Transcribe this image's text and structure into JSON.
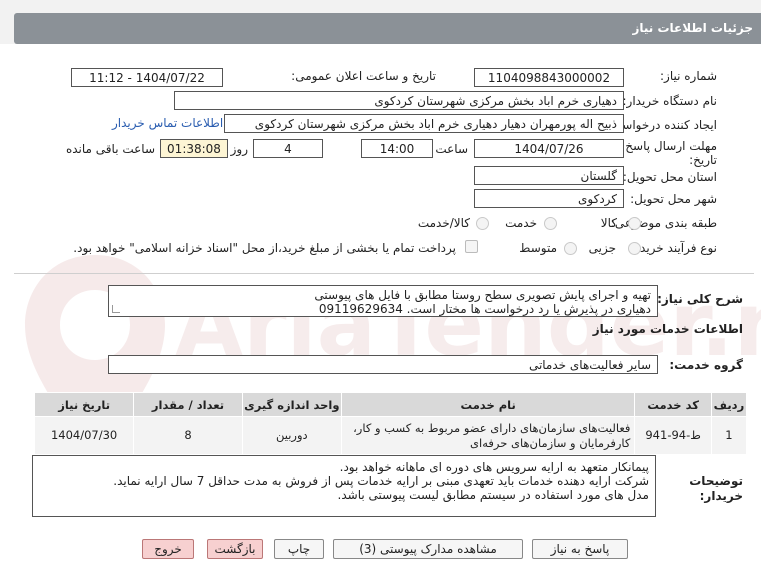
{
  "header": {
    "title": "جزئیات اطلاعات نیاز"
  },
  "form": {
    "need_number_label": "شماره نیاز:",
    "need_number": "1104098843000002",
    "announce_label": "تاریخ و ساعت اعلان عمومی:",
    "announce_value": "1404/07/22 - 11:12",
    "buyer_org_label": "نام دستگاه خریدار:",
    "buyer_org": "دهیاری خرم اباد بخش مرکزی شهرستان کردکوی",
    "creator_label": "ایجاد کننده درخواست:",
    "creator": "ذبیح اله پورمهران دهیار دهیاری خرم اباد بخش مرکزی شهرستان کردکوی",
    "contact_link": "اطلاعات تماس خریدار",
    "deadline_label_1": "مهلت ارسال پاسخ: تا",
    "deadline_label_2": "تاریخ:",
    "deadline_date": "1404/07/26",
    "time_label": "ساعت",
    "deadline_time": "14:00",
    "days_value": "4",
    "days_label": "روز و",
    "remaining_time": "01:38:08",
    "remaining_label": "ساعت باقی مانده",
    "province_label": "استان محل تحویل:",
    "province": "گلستان",
    "city_label": "شهر محل تحویل:",
    "city": "کردکوی",
    "category_label": "طبقه بندی موضوعی:",
    "category_options": [
      "کالا",
      "خدمت",
      "کالا/خدمت"
    ],
    "process_label": "نوع فرآیند خرید :",
    "process_options": [
      "جزیی",
      "متوسط"
    ],
    "payment_note": "پرداخت تمام یا بخشی از مبلغ خرید،از محل \"اسناد خزانه اسلامی\" خواهد بود."
  },
  "summary": {
    "label": "شرح کلی نیاز:",
    "line1": "تهیه و اجرای پایش تصویری سطح روستا مطابق با فایل های پیوستی",
    "line2": "دهیاری در پذیرش یا رد درخواست ها مختار است. 09119629634"
  },
  "services": {
    "title": "اطلاعات خدمات مورد نیاز",
    "group_label": "گروه خدمت:",
    "group_value": "سایر فعالیت‌های خدماتی",
    "columns": [
      "ردیف",
      "کد خدمت",
      "نام خدمت",
      "واحد اندازه گیری",
      "تعداد / مقدار",
      "تاریخ نیاز"
    ],
    "rows": [
      {
        "index": "1",
        "code": "ط-94-941",
        "name_line1": "فعالیت‌های سازمان‌های دارای عضو مربوط به کسب و کار،",
        "name_line2": "کارفرمایان و سازمان‌های حرفه‌ای",
        "unit": "دوربین",
        "qty": "8",
        "date": "1404/07/30"
      }
    ]
  },
  "notes": {
    "label_1": "توضیحات",
    "label_2": "خریدار:",
    "line1": "پیمانکار متعهد به ارایه سرویس های دوره ای ماهانه خواهد بود.",
    "line2": "شرکت ارایه دهنده خدمات باید تعهدی مبنی بر ارایه خدمات پس از فروش به مدت حداقل 7 سال ارایه نماید.",
    "line3": "مدل های مورد استفاده در سیستم مطابق لیست پیوستی باشد."
  },
  "buttons": {
    "respond": "پاسخ به نیاز",
    "attachments": "مشاهده مدارک پیوستی (3)",
    "print": "چاپ",
    "back": "بازگشت",
    "exit": "خروج"
  },
  "watermark_text": "AriaTender.net",
  "colors": {
    "header_bg": "#8b9197",
    "link": "#2a5db0",
    "time_bg": "#fdf5d4",
    "exit_bg": "#f7d0d0"
  }
}
